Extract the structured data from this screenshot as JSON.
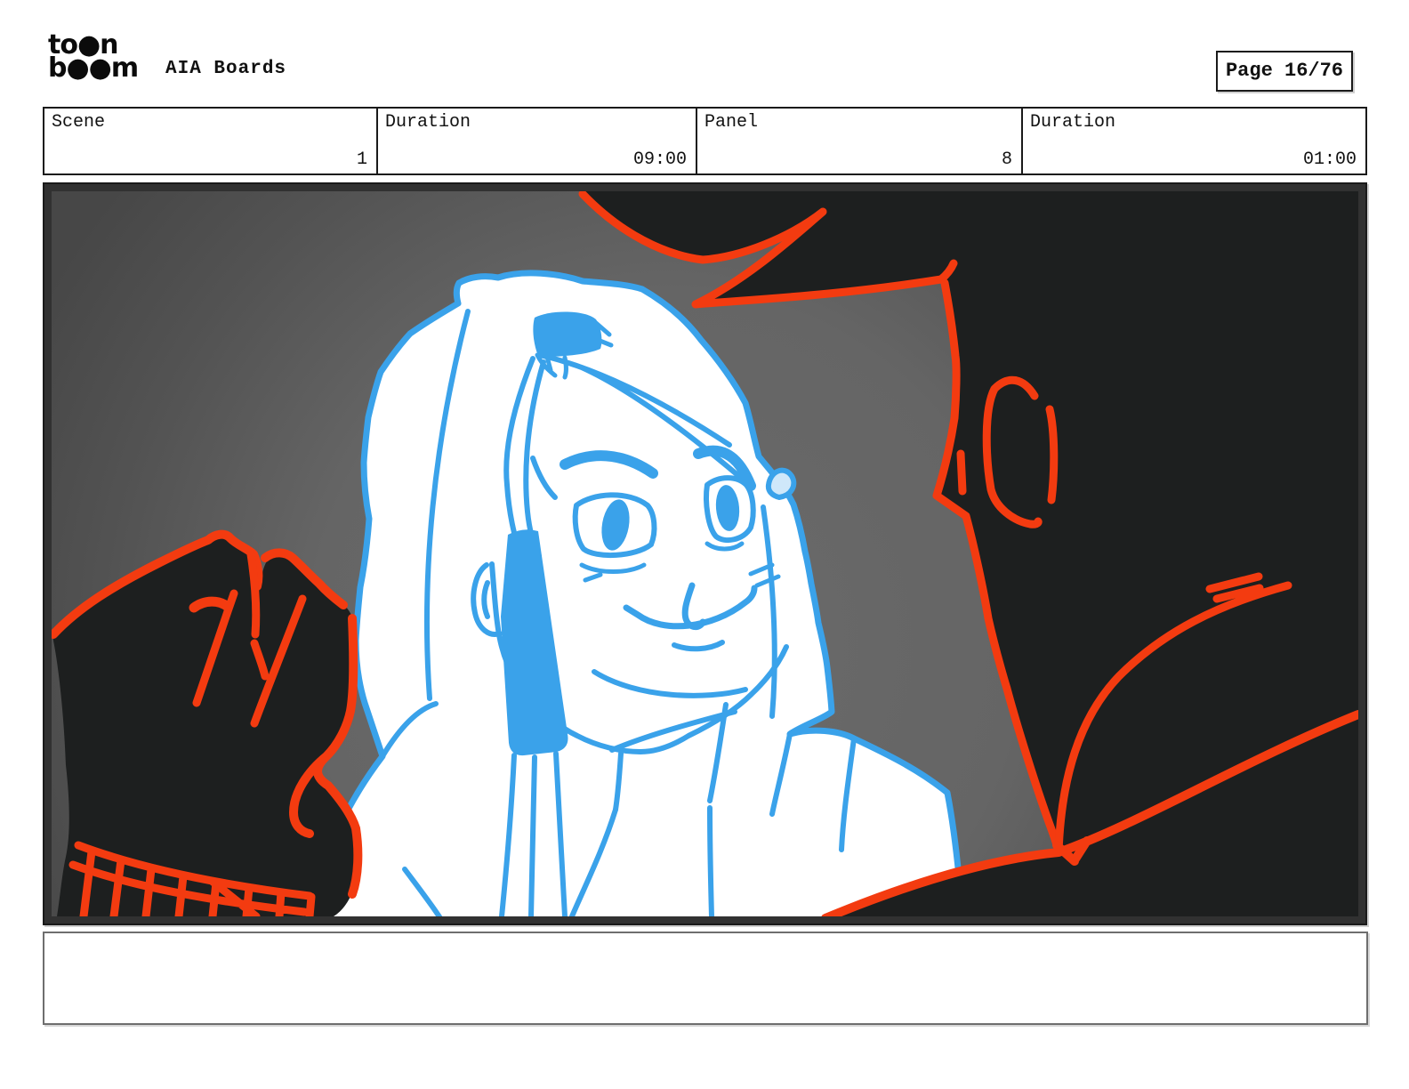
{
  "header": {
    "logo": {
      "line1": "to●n",
      "line2": "b●●m"
    },
    "title": "AIA Boards",
    "page_label": "Page 16/76"
  },
  "info_row": {
    "cells": [
      {
        "label": "Scene",
        "value": "1"
      },
      {
        "label": "Duration",
        "value": "09:00"
      },
      {
        "label": "Panel",
        "value": "8"
      },
      {
        "label": "Duration",
        "value": "01:00"
      }
    ]
  },
  "panel": {
    "alt": "Storyboard sketch: smiling girl drawn in blue lines over white, between a dark red-outlined fist in the lower left and the dark silhouette of a spiky-haired man seen from behind on the right, on a gray background",
    "colors": {
      "background_gray_center": "#6a6a6a",
      "background_gray_edge": "#474747",
      "silhouette_dark": "#1d1f1f",
      "outline_red": "#f33b10",
      "sketch_blue": "#3aa2ea",
      "figure_white": "#ffffff"
    }
  },
  "caption": {
    "value": ""
  }
}
